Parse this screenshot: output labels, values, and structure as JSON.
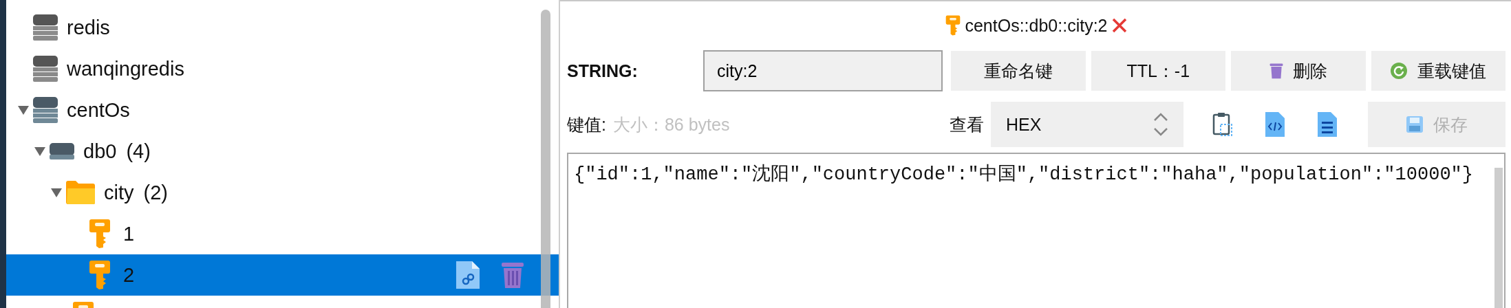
{
  "tree": [
    {
      "kind": "server",
      "label": "redis",
      "selected": false
    },
    {
      "kind": "server",
      "label": "wanqingredis",
      "selected": false
    },
    {
      "kind": "server",
      "label": "centOs",
      "expanded": true,
      "selected": false,
      "children": [
        {
          "kind": "database",
          "label": "db0",
          "count": "(4)",
          "expanded": true,
          "selected": false,
          "children": [
            {
              "kind": "folder",
              "label": "city",
              "count": "(2)",
              "expanded": true,
              "selected": false,
              "children": [
                {
                  "kind": "key",
                  "label": "1",
                  "selected": false
                },
                {
                  "kind": "key",
                  "label": "2",
                  "selected": true
                }
              ]
            },
            {
              "kind": "key",
              "selected": false
            }
          ]
        }
      ]
    }
  ],
  "tab": {
    "title": "centOs::db0::city:2"
  },
  "key_bar": {
    "type": "STRING:",
    "key_name": "city:2",
    "buttons": [
      {
        "kind": "rename",
        "label": "重命名键"
      },
      {
        "kind": "ttl",
        "label": "TTL：-1"
      },
      {
        "kind": "delete",
        "label": "删除"
      },
      {
        "kind": "reload",
        "label": "重载键值"
      }
    ]
  },
  "value_bar": {
    "label": "键值:",
    "size": "大小：86 bytes",
    "view_label": "查看",
    "view_mode": "HEX",
    "save": {
      "label": "保存",
      "disabled": true
    }
  },
  "value": "{\"id\":1,\"name\":\"沈阳\",\"countryCode\":\"中国\",\"district\":\"haha\",\"population\":\"10000\"}"
}
